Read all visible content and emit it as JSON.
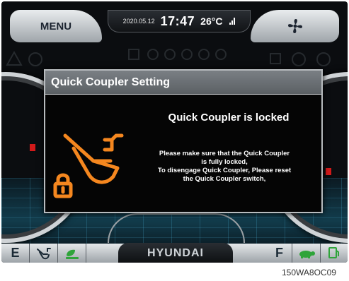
{
  "header": {
    "menu_label": "MENU",
    "date": "2020.05.12",
    "time": "17:47",
    "temperature": "26°C",
    "fan_icon": "fan-icon",
    "signal_icon": "signal-icon"
  },
  "dialog": {
    "title": "Quick Coupler Setting",
    "heading": "Quick Coupler is locked",
    "body_lines": [
      "Please make sure that the Quick Coupler",
      "is fully locked,",
      "To disengage Quick Coupler, Please reset",
      "the Quick Coupler switch,"
    ],
    "icon": "quick-coupler-locked-icon",
    "accent_color": "#f5871f"
  },
  "bottom_bar": {
    "left_label": "E",
    "right_label": "F",
    "brand": "HYUNDAI",
    "icons": [
      "quick-coupler-icon",
      "eco-icon",
      "turtle-icon",
      "fuel-icon"
    ],
    "eco_color": "#2fa43a"
  },
  "caption": "150WA8OC09"
}
